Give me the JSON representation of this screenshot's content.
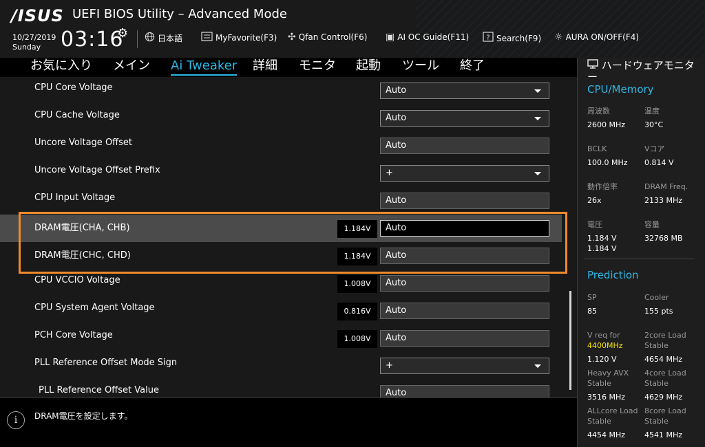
{
  "header": {
    "logo": "/ISUS",
    "title": "UEFI BIOS Utility – Advanced Mode",
    "date": "10/27/2019",
    "weekday": "Sunday",
    "time": "03:16",
    "toolbar": {
      "language": "日本語",
      "favorite": "MyFavorite(F3)",
      "qfan": "Qfan Control(F6)",
      "aioc": "AI OC Guide(F11)",
      "search": "Search(F9)",
      "aura": "AURA ON/OFF(F4)"
    }
  },
  "menu": {
    "tabs": [
      "お気に入り",
      "メイン",
      "Ai Tweaker",
      "詳細",
      "モニタ",
      "起動",
      "ツール",
      "終了"
    ],
    "active_tab": "Ai Tweaker"
  },
  "settings": [
    {
      "label": "CPU Core Voltage",
      "value": "Auto",
      "current": "",
      "type": "dropdown"
    },
    {
      "label": "CPU Cache Voltage",
      "value": "Auto",
      "current": "",
      "type": "dropdown"
    },
    {
      "label": "Uncore Voltage Offset",
      "value": "Auto",
      "current": "",
      "type": "input"
    },
    {
      "label": "Uncore Voltage Offset Prefix",
      "value": "+",
      "current": "",
      "type": "dropdown"
    },
    {
      "label": "CPU Input Voltage",
      "value": "Auto",
      "current": "",
      "type": "input"
    },
    {
      "label": "DRAM電圧(CHA, CHB)",
      "value": "Auto",
      "current": "1.184V",
      "type": "input",
      "selected": true
    },
    {
      "label": "DRAM電圧(CHC, CHD)",
      "value": "Auto",
      "current": "1.184V",
      "type": "input"
    },
    {
      "label": "CPU VCCIO Voltage",
      "value": "Auto",
      "current": "1.008V",
      "type": "input"
    },
    {
      "label": "CPU System Agent Voltage",
      "value": "Auto",
      "current": "0.816V",
      "type": "input"
    },
    {
      "label": "PCH Core Voltage",
      "value": "Auto",
      "current": "1.008V",
      "type": "input"
    },
    {
      "label": "PLL Reference Offset Mode Sign",
      "value": "+",
      "current": "",
      "type": "dropdown"
    },
    {
      "label": "PLL Reference Offset Value",
      "value": "Auto",
      "current": "",
      "type": "input"
    }
  ],
  "help": {
    "text": "DRAM電圧を設定します。"
  },
  "monitor": {
    "title": "ハードウェアモニター",
    "cpu_memory_title": "CPU/Memory",
    "cpu": {
      "freq_label": "周波数",
      "freq_value": "2600 MHz",
      "temp_label": "温度",
      "temp_value": "30°C",
      "bclk_label": "BCLK",
      "bclk_value": "100.0 MHz",
      "vcore_label": "Vコア",
      "vcore_value": "0.814 V",
      "ratio_label": "動作倍率",
      "ratio_value": "26x",
      "dramfreq_label": "DRAM Freq.",
      "dramfreq_value": "2133 MHz",
      "volt_label": "電圧",
      "volt_value1": "1.184 V",
      "volt_value2": "1.184 V",
      "cap_label": "容量",
      "cap_value": "32768 MB"
    },
    "prediction_title": "Prediction",
    "prediction": {
      "sp_label": "SP",
      "sp_value": "85",
      "cooler_label": "Cooler",
      "cooler_value": "155 pts",
      "vreq_label": "V req for",
      "vreq_freq": "4400MHz",
      "vreq_value": "1.120 V",
      "c2_label1": "2core Load",
      "c2_label2": "Stable",
      "c2_value": "4654 MHz",
      "avx_label1": "Heavy AVX",
      "avx_label2": "Stable",
      "avx_value": "3516 MHz",
      "c4_label1": "4core Load",
      "c4_label2": "Stable",
      "c4_value": "4629 MHz",
      "all_label1": "ALLcore Load",
      "all_label2": "Stable",
      "all_value": "4454 MHz",
      "c8_label1": "8core Load",
      "c8_label2": "Stable",
      "c8_value": "4541 MHz"
    }
  },
  "colors": {
    "accent": "#2eb8e6",
    "highlight_box": "#f08a2c",
    "freq_highlight": "#f2e600"
  }
}
